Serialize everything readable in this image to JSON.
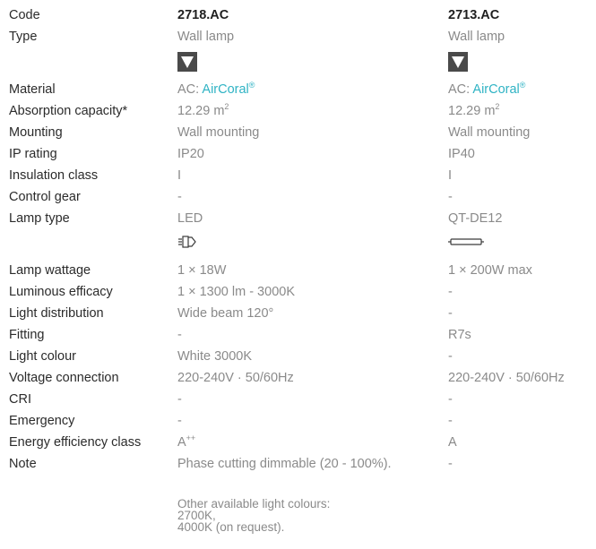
{
  "headers": {
    "code_label": "Code",
    "type_label": "Type",
    "col1_code": "2718.AC",
    "col1_type": "Wall lamp",
    "col2_code": "2713.AC",
    "col2_type": "Wall lamp",
    "shape_icon": "downward-triangle-icon"
  },
  "rows": [
    {
      "label": "Material",
      "v1_prefix": "AC: ",
      "v1_brand": "AirCoral",
      "v1_reg": "®",
      "v2_prefix": "AC: ",
      "v2_brand": "AirCoral",
      "v2_reg": "®"
    },
    {
      "label": "Absorption capacity*",
      "v1": "12.29 m",
      "v1_sup": "2",
      "v2": "12.29 m",
      "v2_sup": "2"
    },
    {
      "label": "Mounting",
      "v1": "Wall mounting",
      "v2": "Wall mounting"
    },
    {
      "label": "IP rating",
      "v1": "IP20",
      "v2": "IP40"
    },
    {
      "label": "Insulation class",
      "v1": "I",
      "v2": "I"
    },
    {
      "label": "Control gear",
      "v1": "-",
      "v2": "-"
    },
    {
      "label": "Lamp type",
      "v1": "LED",
      "v2": "QT-DE12"
    },
    {
      "label": "Lamp wattage",
      "v1": "1 × 18W",
      "v2": "1 × 200W max"
    },
    {
      "label": "Luminous efficacy",
      "v1": "1 × 1300 lm - 3000K",
      "v2": "-"
    },
    {
      "label": "Light distribution",
      "v1": "Wide beam 120°",
      "v2": "-"
    },
    {
      "label": "Fitting",
      "v1": "-",
      "v2": "R7s"
    },
    {
      "label": "Light colour",
      "v1": "White 3000K",
      "v2": "-"
    },
    {
      "label": "Voltage connection",
      "v1": "220-240V · 50/60Hz",
      "v2": "220-240V · 50/60Hz"
    },
    {
      "label": "CRI",
      "v1": "-",
      "v2": "-"
    },
    {
      "label": "Emergency",
      "v1": "-",
      "v2": "-"
    },
    {
      "label": "Energy efficiency class",
      "v1": "A",
      "v1_sup": "++",
      "v2": "A"
    },
    {
      "label": "Note",
      "v1": "Phase cutting dimmable (20 - 100%).",
      "v2": "-"
    }
  ],
  "lamp_icons": {
    "col1": "led-module-icon",
    "col2": "linear-tube-lamp-icon"
  },
  "note_extra": "Other available light colours:\n2700K,\n4000K (on request).",
  "colors": {
    "accent": "#2fb3c4",
    "label": "#2b2b2b",
    "value": "#8a8a8a"
  }
}
